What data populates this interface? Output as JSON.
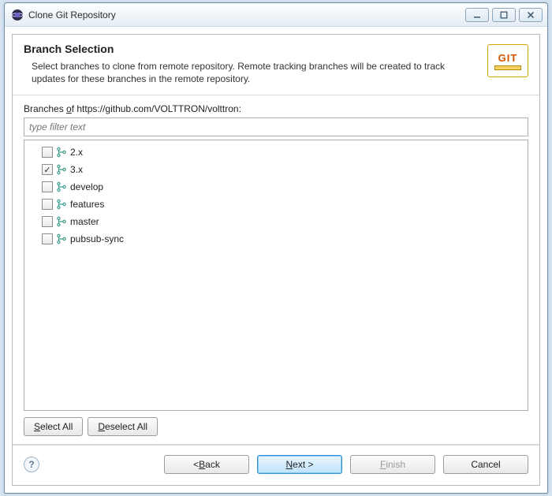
{
  "window": {
    "title": "Clone Git Repository"
  },
  "header": {
    "title": "Branch Selection",
    "description": "Select branches to clone from remote repository. Remote tracking branches will be created to track updates for these branches in the remote repository."
  },
  "body": {
    "branches_of_prefix": "Branches ",
    "branches_of_underlined": "o",
    "branches_of_suffix": "f https://github.com/VOLTTRON/volttron:",
    "filter_placeholder": "type filter text",
    "branches": [
      {
        "name": "2.x",
        "checked": false
      },
      {
        "name": "3.x",
        "checked": true
      },
      {
        "name": "develop",
        "checked": false
      },
      {
        "name": "features",
        "checked": false
      },
      {
        "name": "master",
        "checked": false
      },
      {
        "name": "pubsub-sync",
        "checked": false
      }
    ],
    "select_all_u": "S",
    "select_all_rest": "elect All",
    "deselect_all_u": "D",
    "deselect_all_rest": "eselect All"
  },
  "footer": {
    "back_prefix": "< ",
    "back_u": "B",
    "back_rest": "ack",
    "next_u": "N",
    "next_rest": "ext >",
    "finish_u": "F",
    "finish_rest": "inish",
    "cancel": "Cancel"
  },
  "git_badge": {
    "text": "GIT"
  }
}
